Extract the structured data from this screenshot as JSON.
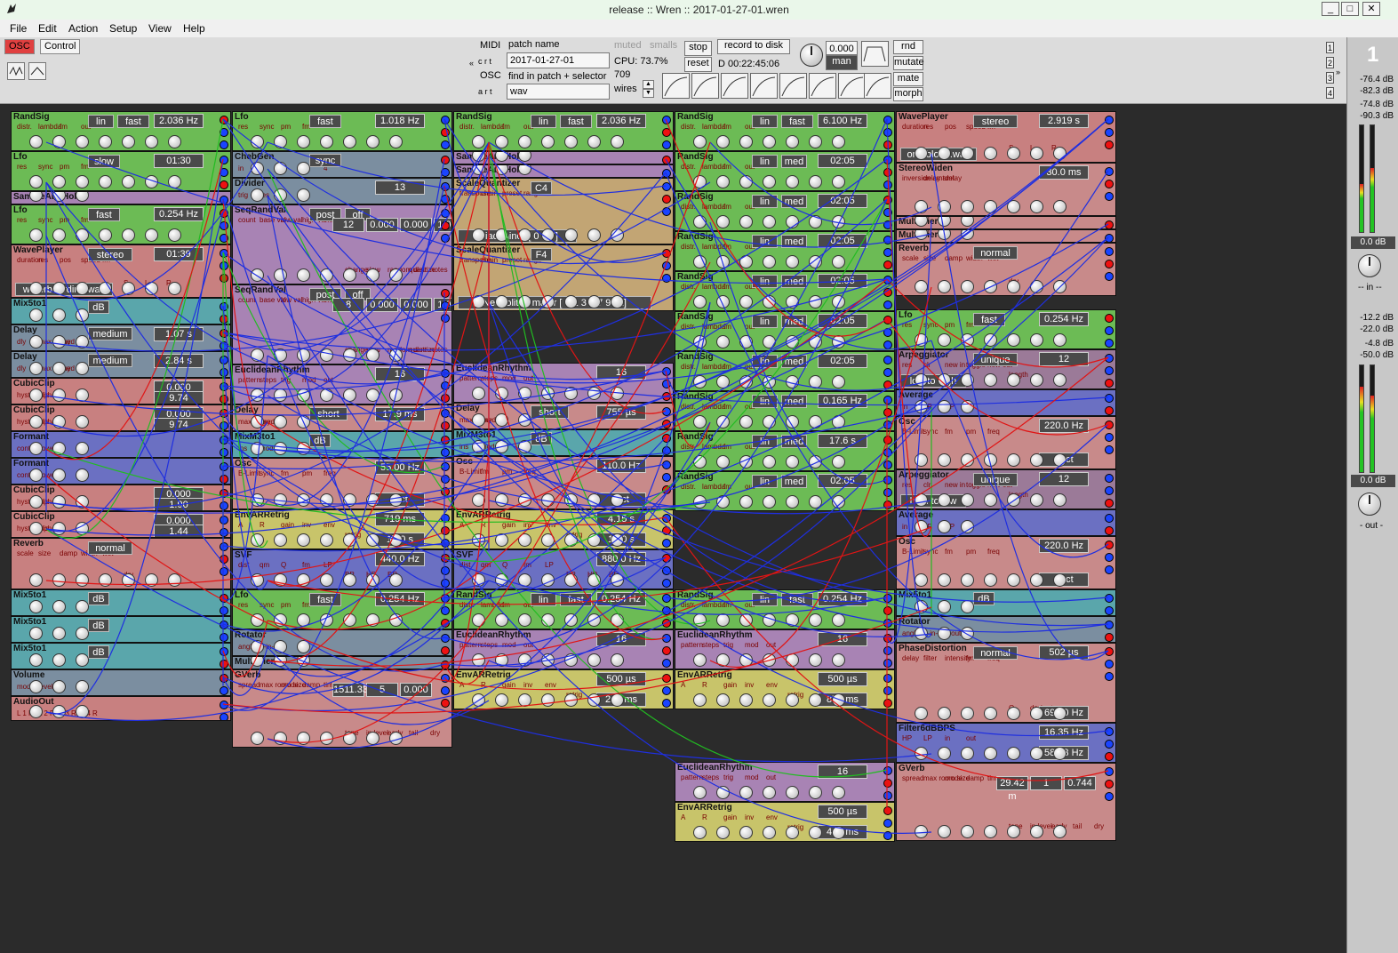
{
  "window": {
    "title": "release  ::  Wren  ::  2017-01-27-01.wren",
    "buttons": [
      "_",
      "□",
      "✕"
    ]
  },
  "menu": [
    "File",
    "Edit",
    "Action",
    "Setup",
    "View",
    "Help"
  ],
  "toolbar": {
    "tab_osc": "OSC",
    "tab_control": "Control",
    "midi_label": "MIDI",
    "osc_label": "OSC",
    "crt": "c r t",
    "art": "a r t",
    "patch_name_label": "patch name",
    "patch_name_value": "2017-01-27-01",
    "find_label": "find in patch + selector",
    "find_value": "wav",
    "muted": "muted",
    "smalls": "smalls",
    "cpu": "CPU: 73.7%",
    "count": "709",
    "wires": "wires",
    "stop": "stop",
    "record": "record to disk",
    "reset": "reset",
    "duration": "D 00:22:45:06",
    "value": "0.000",
    "man": "man",
    "rnd": "rnd",
    "mutate": "mutate",
    "mate": "mate",
    "morph": "morph",
    "page_buttons": [
      "1",
      "2",
      "3",
      "4"
    ]
  },
  "meters": {
    "channel": "1",
    "top_levels": [
      "-76.4 dB",
      "-82.3 dB",
      "-74.8 dB",
      "-90.3 dB"
    ],
    "in_value": "0.0 dB",
    "in_label": "-- in --",
    "mid_levels": [
      "-12.2 dB",
      "-22.0 dB",
      "-4.8 dB",
      "-50.0 dB"
    ],
    "out_value": "0.0 dB",
    "out_label": "- out -",
    "in_fill": [
      0.45,
      0.6
    ],
    "out_fill": [
      0.8,
      0.72
    ]
  },
  "modules": [
    {
      "name": "RandSig",
      "color": "green",
      "pills": [
        "lin",
        "fast"
      ],
      "value": "2.036 Hz",
      "labels": [
        "distr.",
        "lambda",
        "fm",
        "out"
      ]
    },
    {
      "name": "Lfo",
      "color": "green",
      "pills": [
        "slow"
      ],
      "value": "01:30",
      "labels": [
        "res",
        "sync",
        "pm",
        "fm"
      ]
    },
    {
      "name": "SampleAndHold",
      "color": "purple",
      "pills": [],
      "value": "",
      "labels": [
        "trig",
        "in"
      ]
    },
    {
      "name": "Lfo",
      "color": "green",
      "pills": [
        "fast"
      ],
      "value": "0.254 Hz",
      "labels": [
        "res",
        "sync",
        "pm",
        "fm"
      ]
    },
    {
      "name": "WavePlayer",
      "color": "pink",
      "pills": [
        "waterboarding.wav",
        "stereo"
      ],
      "value": "01:39",
      "labels": [
        "duration",
        "res",
        "pos",
        "speed",
        "fm",
        "S",
        "L",
        "R"
      ]
    },
    {
      "name": "Mix5to1",
      "color": "teal",
      "pills": [
        "dB"
      ],
      "value": "",
      "labels": []
    },
    {
      "name": "Delay",
      "color": "gray",
      "pills": [
        "medium"
      ],
      "value": "1.07 s",
      "labels": [
        "dly",
        "max delay",
        "fixed"
      ]
    },
    {
      "name": "Delay",
      "color": "gray",
      "pills": [
        "medium"
      ],
      "value": "2.84 s",
      "labels": [
        "dly",
        "max delay",
        "fixed"
      ]
    },
    {
      "name": "CubicClip",
      "color": "pink",
      "pills": [],
      "value": "0.000",
      "value2": "9.74",
      "labels": [
        "hysteresis",
        "alpha"
      ]
    },
    {
      "name": "CubicClip",
      "color": "pink",
      "pills": [],
      "value": "0.000",
      "value2": "9.74",
      "labels": [
        "hysteresis",
        "alpha"
      ]
    },
    {
      "name": "Formant",
      "color": "blue",
      "pills": [],
      "value": "",
      "labels": [
        "control",
        "vowel",
        "in"
      ]
    },
    {
      "name": "Formant",
      "color": "blue",
      "pills": [],
      "value": "",
      "labels": [
        "control",
        "vowel",
        "in"
      ]
    },
    {
      "name": "CubicClip",
      "color": "pink",
      "pills": [],
      "value": "0.000",
      "value2": "1.90",
      "labels": [
        "hysteresis",
        "alpha"
      ]
    },
    {
      "name": "CubicClip",
      "color": "pink",
      "pills": [],
      "value": "0.000",
      "value2": "1.44",
      "labels": [
        "hysteresis",
        "alpha"
      ]
    },
    {
      "name": "Reverb",
      "color": "pink",
      "pills": [
        "normal"
      ],
      "value": "",
      "labels": [
        "scale",
        "size",
        "damp",
        "width",
        "wet",
        "dry"
      ]
    },
    {
      "name": "Mix5to1",
      "color": "teal",
      "pills": [
        "dB"
      ],
      "value": "",
      "labels": []
    },
    {
      "name": "Mix5to1",
      "color": "teal",
      "pills": [
        "dB"
      ],
      "value": "",
      "labels": []
    },
    {
      "name": "Mix5to1",
      "color": "teal",
      "pills": [
        "dB"
      ],
      "value": "",
      "labels": []
    },
    {
      "name": "Volume",
      "color": "gray",
      "pills": [],
      "value": "",
      "labels": [
        "mod",
        "level"
      ]
    },
    {
      "name": "AudioOut",
      "color": "pink",
      "pills": [],
      "value": "",
      "labels": [
        "L 1 R",
        "L 2 R",
        "L 3 R",
        "L 4 R"
      ]
    },
    {
      "name": "Lfo",
      "color": "green",
      "pills": [
        "fast"
      ],
      "value": "1.018 Hz",
      "labels": [
        "res",
        "sync",
        "pm",
        "fm"
      ]
    },
    {
      "name": "ChebGen",
      "color": "gray",
      "pills": [
        "sync"
      ],
      "value": "",
      "labels": [
        "in",
        "1",
        "2",
        "3",
        "4",
        "5",
        "6",
        "7",
        "8",
        "9",
        "10",
        "11",
        "12",
        "13"
      ]
    },
    {
      "name": "Divider",
      "color": "gray",
      "pills": [],
      "value": "13",
      "labels": [
        "trig",
        "res"
      ]
    },
    {
      "name": "SeqRandVal",
      "color": "purple",
      "pills": [
        "post",
        "off"
      ],
      "value": "12",
      "value2": "0.000",
      "value3": "0.000",
      "value4": "1.000",
      "labels": [
        "count",
        "base val",
        "low val",
        "high val",
        "step",
        "change",
        "slew",
        "random distr.",
        "quantize",
        "notes",
        "1/1",
        "chain",
        "out"
      ]
    },
    {
      "name": "SeqRandVal",
      "color": "purple",
      "pills": [
        "post",
        "off"
      ],
      "value": "8",
      "value2": "0.000",
      "value3": "0.000",
      "value4": "1.000",
      "labels": [
        "count",
        "base val",
        "low val",
        "high val",
        "step",
        "change",
        "slew",
        "random distr.",
        "quantize",
        "notes",
        "1/1",
        "chain",
        "out"
      ]
    },
    {
      "name": "EuclideanRhythm",
      "color": "purple",
      "pills": [],
      "value": "16",
      "labels": [
        "pattern",
        "steps",
        "trig",
        "mod",
        "out"
      ]
    },
    {
      "name": "Delay",
      "color": "rose",
      "pills": [
        "short"
      ],
      "value": "17.9 ms",
      "labels": [
        "max delay",
        "fixed"
      ]
    },
    {
      "name": "MixM3to1",
      "color": "teal",
      "pills": [
        "dB"
      ],
      "value": "",
      "labels": [
        "ins",
        "mods"
      ]
    },
    {
      "name": "Osc",
      "color": "rose",
      "pills": [],
      "value": "55.00 Hz",
      "value2": "0 ct",
      "labels": [
        "B-Limit",
        "sync",
        "fm",
        "pm",
        "freq"
      ]
    },
    {
      "name": "EnvARRetrig",
      "color": "yellow",
      "pills": [],
      "value": "719 ms",
      "value2": "12.0 s",
      "labels": [
        "A",
        "R",
        "gain",
        "inv",
        "env",
        "retrig"
      ]
    },
    {
      "name": "SVF",
      "color": "blue",
      "pills": [],
      "value": "440.0 Hz",
      "labels": [
        "dist",
        "qm",
        "Q",
        "fm",
        "LP",
        "BP",
        "HP",
        "BR"
      ]
    },
    {
      "name": "Lfo",
      "color": "green",
      "pills": [
        "fast"
      ],
      "value": "0.254 Hz",
      "labels": [
        "res",
        "sync",
        "pm",
        "fm"
      ]
    },
    {
      "name": "Rotator",
      "color": "gray",
      "pills": [],
      "value": "",
      "labels": [
        "angle",
        "1-in-2"
      ]
    },
    {
      "name": "Multiplier",
      "color": "gray",
      "pills": [],
      "value": "",
      "labels": []
    },
    {
      "name": "GVerb",
      "color": "rose",
      "pills": [],
      "value": "1511.33",
      "value2": "5",
      "value3": "0.000",
      "labels": [
        "spread",
        "max room size",
        "mode",
        "damp",
        "time",
        "tone",
        "in level",
        "early",
        "tail",
        "dry",
        "mod",
        "relative room size"
      ]
    },
    {
      "name": "RandSig",
      "color": "green",
      "pills": [
        "lin",
        "fast"
      ],
      "value": "2.036 Hz",
      "labels": [
        "distr.",
        "lambda",
        "fm",
        "out"
      ]
    },
    {
      "name": "SampleAndHold",
      "color": "purple",
      "pills": [],
      "value": "",
      "labels": [
        "trig",
        "in"
      ]
    },
    {
      "name": "SampleAndHold",
      "color": "purple",
      "pills": [],
      "value": "",
      "labels": [
        "trig",
        "in"
      ]
    },
    {
      "name": "ScaleQuantizer",
      "color": "tan",
      "pills": [
        "C4",
        "Triad minor  [ 0 3 7]"
      ],
      "value": "",
      "labels": [
        "transpose",
        "chain",
        "preset",
        "range"
      ]
    },
    {
      "name": "ScaleQuantizer",
      "color": "tan",
      "pills": [
        "F4",
        "Neapolitan major  [ 0 1 3 5 7 9 11]"
      ],
      "value": "",
      "labels": [
        "transpose",
        "chain",
        "preset",
        "range"
      ]
    },
    {
      "name": "EuclideanRhythm",
      "color": "purple",
      "pills": [],
      "value": "16",
      "labels": [
        "pattern",
        "steps",
        "mod",
        "out"
      ]
    },
    {
      "name": "Delay",
      "color": "rose",
      "pills": [
        "short"
      ],
      "value": "755 µs",
      "labels": [
        "max delay",
        "fixed"
      ]
    },
    {
      "name": "MixM3to1",
      "color": "teal",
      "pills": [
        "dB"
      ],
      "value": "",
      "labels": [
        "ins",
        "mods"
      ]
    },
    {
      "name": "Osc",
      "color": "rose",
      "pills": [],
      "value": "110.0 Hz",
      "value2": "0 ct",
      "labels": [
        "B-Limit",
        "fm",
        "pm",
        "freq"
      ]
    },
    {
      "name": "EnvARRetrig",
      "color": "yellow",
      "pills": [],
      "value": "4.15 s",
      "value2": "12.0 s",
      "labels": [
        "A",
        "R",
        "gain",
        "inv",
        "env",
        "retrig"
      ]
    },
    {
      "name": "SVF",
      "color": "blue",
      "pills": [],
      "value": "880.0 Hz",
      "labels": [
        "dist",
        "qm",
        "Q",
        "fm",
        "LP",
        "BP",
        "HP",
        "BR"
      ]
    },
    {
      "name": "RandSig",
      "color": "green",
      "pills": [
        "lin",
        "fast"
      ],
      "value": "0.254 Hz",
      "labels": [
        "distr.",
        "lambda",
        "fm",
        "out"
      ]
    },
    {
      "name": "EuclideanRhythm",
      "color": "purple",
      "pills": [],
      "value": "16",
      "labels": [
        "pattern",
        "steps",
        "mod",
        "out"
      ]
    },
    {
      "name": "EnvARRetrig",
      "color": "yellow",
      "pills": [],
      "value": "500 µs",
      "value2": "210 ms",
      "labels": [
        "A",
        "R",
        "gain",
        "inv",
        "env",
        "retrig"
      ]
    },
    {
      "name": "RandSig",
      "color": "green",
      "pills": [
        "lin",
        "fast"
      ],
      "value": "6.100 Hz",
      "labels": [
        "distr.",
        "lambda",
        "fm",
        "out"
      ]
    },
    {
      "name": "RandSig",
      "color": "green",
      "pills": [
        "lin",
        "med"
      ],
      "value": "02:05",
      "labels": [
        "distr.",
        "lambda",
        "fm",
        "out"
      ]
    },
    {
      "name": "RandSig",
      "color": "green",
      "pills": [
        "lin",
        "med"
      ],
      "value": "02:05",
      "labels": [
        "distr.",
        "lambda",
        "fm",
        "out"
      ]
    },
    {
      "name": "RandSig",
      "color": "green",
      "pills": [
        "lin",
        "med"
      ],
      "value": "02:05",
      "labels": [
        "distr.",
        "lambda",
        "fm",
        "out"
      ]
    },
    {
      "name": "RandSig",
      "color": "green",
      "pills": [
        "lin",
        "med"
      ],
      "value": "02:05",
      "labels": [
        "distr.",
        "lambda",
        "fm",
        "out"
      ]
    },
    {
      "name": "RandSig",
      "color": "green",
      "pills": [
        "lin",
        "med"
      ],
      "value": "02:05",
      "labels": [
        "distr.",
        "lambda",
        "fm",
        "out"
      ]
    },
    {
      "name": "RandSig",
      "color": "green",
      "pills": [
        "lin",
        "med"
      ],
      "value": "02:05",
      "labels": [
        "distr.",
        "lambda",
        "fm",
        "out"
      ]
    },
    {
      "name": "RandSig",
      "color": "green",
      "pills": [
        "lin",
        "med"
      ],
      "value": "0.165 Hz",
      "labels": [
        "distr.",
        "lambda",
        "fm",
        "out"
      ]
    },
    {
      "name": "RandSig",
      "color": "green",
      "pills": [
        "lin",
        "med"
      ],
      "value": "17.6 s",
      "labels": [
        "distr.",
        "lambda",
        "fm",
        "out"
      ]
    },
    {
      "name": "RandSig",
      "color": "green",
      "pills": [
        "lin",
        "med"
      ],
      "value": "02:05",
      "labels": [
        "distr.",
        "lambda",
        "fm",
        "out"
      ]
    },
    {
      "name": "RandSig",
      "color": "green",
      "pills": [
        "lin",
        "fast"
      ],
      "value": "0.254 Hz",
      "labels": [
        "distr.",
        "lambda",
        "fm",
        "out"
      ]
    },
    {
      "name": "EuclideanRhythm",
      "color": "purple",
      "pills": [],
      "value": "16",
      "labels": [
        "pattern",
        "steps",
        "trig",
        "mod",
        "out"
      ]
    },
    {
      "name": "EnvARRetrig",
      "color": "yellow",
      "pills": [],
      "value": "500 µs",
      "value2": "872 ms",
      "labels": [
        "A",
        "R",
        "gain",
        "inv",
        "env",
        "retrig"
      ]
    },
    {
      "name": "EuclideanRhythm",
      "color": "purple",
      "pills": [],
      "value": "16",
      "labels": [
        "pattern",
        "steps",
        "trig",
        "mod",
        "out"
      ]
    },
    {
      "name": "EnvARRetrig",
      "color": "yellow",
      "pills": [],
      "value": "500 µs",
      "value2": "402 ms",
      "labels": [
        "A",
        "R",
        "gain",
        "inv",
        "env",
        "retrig"
      ]
    },
    {
      "name": "WavePlayer",
      "color": "pink",
      "pills": [
        "one blood.wav",
        "stereo"
      ],
      "value": "2.919 s",
      "labels": [
        "duration",
        "res",
        "pos",
        "speed",
        "fm",
        "S",
        "L",
        "R"
      ]
    },
    {
      "name": "StereoWiden",
      "color": "rose",
      "pills": [],
      "value": "30.0 ms",
      "labels": [
        "inversion amt.",
        "delay amt.",
        "delay"
      ]
    },
    {
      "name": "Multiplier",
      "color": "rose",
      "pills": [],
      "value": "",
      "labels": []
    },
    {
      "name": "Multiplier",
      "color": "rose",
      "pills": [],
      "value": "",
      "labels": []
    },
    {
      "name": "Reverb",
      "color": "rose",
      "pills": [
        "normal"
      ],
      "value": "",
      "labels": [
        "scale",
        "size",
        "damp",
        "width",
        "wet",
        "dry"
      ]
    },
    {
      "name": "Lfo",
      "color": "green",
      "pills": [
        "fast"
      ],
      "value": "0.254 Hz",
      "labels": [
        "res",
        "sync",
        "pm",
        "fm"
      ]
    },
    {
      "name": "Arpeggiator",
      "color": "mauve",
      "pills": [
        "unique",
        "low to high"
      ],
      "value": "12",
      "labels": [
        "res",
        "clr",
        "new in",
        "toggle",
        "new out",
        "length"
      ]
    },
    {
      "name": "Average",
      "color": "blue",
      "pills": [],
      "value": "",
      "labels": [
        "in",
        "LP",
        "HP"
      ]
    },
    {
      "name": "Osc",
      "color": "rose",
      "pills": [],
      "value": "220.0 Hz",
      "value2": "-2 ct",
      "labels": [
        "B-Limit",
        "sync",
        "fm",
        "pm",
        "freq"
      ]
    },
    {
      "name": "Arpeggiator",
      "color": "mauve",
      "pills": [
        "unique",
        "high to low"
      ],
      "value": "12",
      "labels": [
        "res",
        "clr",
        "new in",
        "toggle",
        "new out",
        "length"
      ]
    },
    {
      "name": "Average",
      "color": "blue",
      "pills": [],
      "value": "",
      "labels": [
        "in",
        "LP",
        "HP"
      ]
    },
    {
      "name": "Osc",
      "color": "rose",
      "pills": [],
      "value": "220.0 Hz",
      "value2": "-5 ct",
      "labels": [
        "B-Limit",
        "sync",
        "fm",
        "pm",
        "freq"
      ]
    },
    {
      "name": "Mix5to1",
      "color": "teal",
      "pills": [
        "dB"
      ],
      "value": "",
      "labels": []
    },
    {
      "name": "Rotator",
      "color": "gray",
      "pills": [],
      "value": "",
      "labels": [
        "angle",
        "1-in-2",
        "1-out-2"
      ]
    },
    {
      "name": "PhaseDistortion",
      "color": "rose",
      "pills": [
        "normal"
      ],
      "value": "502 µs",
      "value2": "69.30 Hz",
      "labels": [
        "delay",
        "filter",
        "intensity",
        "fm",
        "freq",
        "Q",
        "dry/wet"
      ]
    },
    {
      "name": "Filter6dBBPS",
      "color": "blue",
      "pills": [],
      "value": "16.35 Hz",
      "value2": "587.3 Hz",
      "labels": [
        "HP",
        "LP",
        "in",
        "out"
      ]
    },
    {
      "name": "GVerb",
      "color": "rose",
      "pills": [],
      "value": "29.42 m",
      "value2": "1",
      "value3": "0.744",
      "labels": [
        "spread",
        "max room size",
        "mode",
        "damp",
        "time",
        "tone",
        "in level",
        "early",
        "tail",
        "dry",
        "mod",
        "relative room size"
      ]
    }
  ]
}
